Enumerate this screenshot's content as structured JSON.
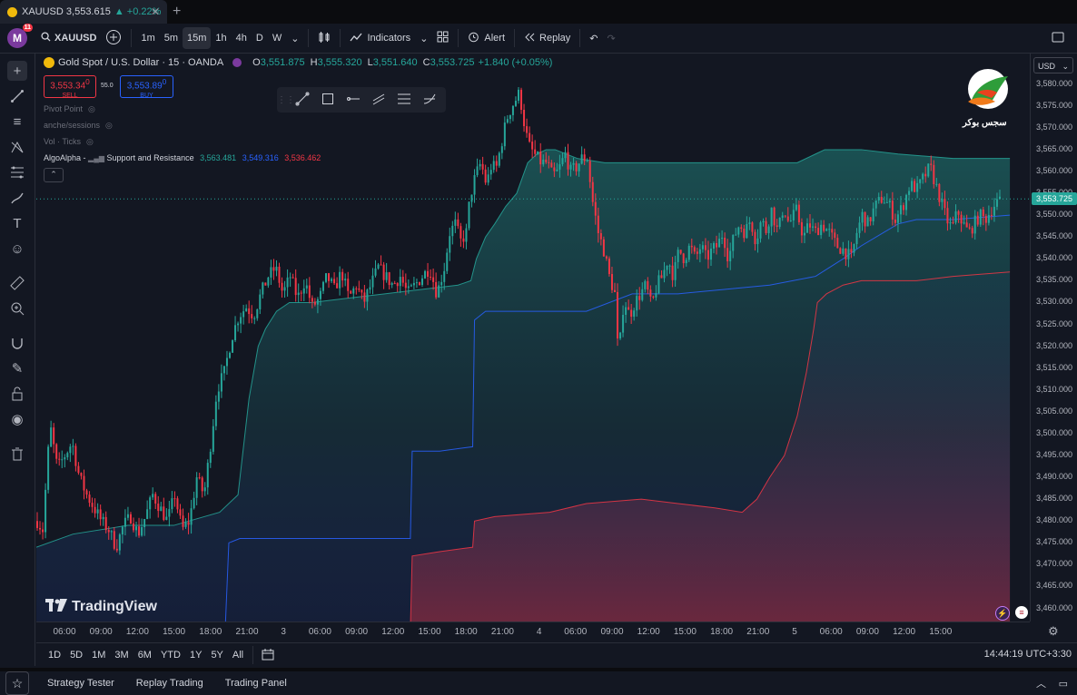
{
  "browser_tab": {
    "symbol": "XAUUSD",
    "price": "3,553.615",
    "change": "▲ +0.22%",
    "close": "✕",
    "new_tab": "+"
  },
  "toolbar": {
    "avatar_letter": "M",
    "avatar_badge": "11",
    "symbol": "XAUUSD",
    "intervals": [
      "1m",
      "5m",
      "15m",
      "1h",
      "4h",
      "D",
      "W"
    ],
    "active_interval": "15m",
    "indicators_label": "Indicators",
    "alert_label": "Alert",
    "replay_label": "Replay"
  },
  "legend": {
    "title": "Gold Spot / U.S. Dollar · 15 · OANDA",
    "o_label": "O",
    "o": "3,551.875",
    "h_label": "H",
    "h": "3,555.320",
    "l_label": "L",
    "l": "3,551.640",
    "c_label": "C",
    "c": "3,553.725",
    "change": "+1.840 (+0.05%)",
    "sell_price": "3,553.34",
    "sell_sup": "0",
    "sell_label": "SELL",
    "spread": "55.0",
    "buy_price": "3,553.89",
    "buy_sup": "0",
    "buy_label": "BUY",
    "indicators": [
      "Pivot Point",
      "anche/sessions",
      "Vol · Ticks"
    ],
    "algo_name": "AlgoAlpha -",
    "algo_title": "Support and Resistance",
    "algo_v1": "3,563.481",
    "algo_v2": "3,549.316",
    "algo_v3": "3,536.462",
    "collapse": "⌃"
  },
  "logo_text": "سجس بوکر",
  "watermark": "TradingView",
  "price_axis": {
    "currency": "USD",
    "labels": [
      "3,580.000",
      "3,575.000",
      "3,570.000",
      "3,565.000",
      "3,560.000",
      "3,555.000",
      "3,550.000",
      "3,545.000",
      "3,540.000",
      "3,535.000",
      "3,530.000",
      "3,525.000",
      "3,520.000",
      "3,515.000",
      "3,510.000",
      "3,505.000",
      "3,500.000",
      "3,495.000",
      "3,490.000",
      "3,485.000",
      "3,480.000",
      "3,475.000",
      "3,470.000",
      "3,465.000",
      "3,460.000"
    ],
    "last_price": "3,553.725"
  },
  "time_axis": {
    "labels": [
      "06:00",
      "09:00",
      "12:00",
      "15:00",
      "18:00",
      "21:00",
      "3",
      "06:00",
      "09:00",
      "12:00",
      "15:00",
      "18:00",
      "21:00",
      "4",
      "06:00",
      "09:00",
      "12:00",
      "15:00",
      "18:00",
      "21:00",
      "5",
      "06:00",
      "09:00",
      "12:00",
      "15:00"
    ]
  },
  "range_bar": {
    "ranges": [
      "1D",
      "5D",
      "1M",
      "3M",
      "6M",
      "YTD",
      "1Y",
      "5Y",
      "All"
    ],
    "clock": "14:44:19 UTC+3:30"
  },
  "bottom_panel": {
    "tabs": [
      "Strategy Tester",
      "Replay Trading",
      "Trading Panel"
    ]
  },
  "colors": {
    "up": "#26a69a",
    "down": "#f23645",
    "support": "#2962ff",
    "bg": "#131722"
  },
  "chart_data": {
    "type": "candlestick",
    "instrument": "XAUUSD",
    "timeframe": "15",
    "ylim": [
      3457,
      3587
    ],
    "last_close": 3553.725,
    "price_path": [
      [
        0,
        3480
      ],
      [
        6,
        3478
      ],
      [
        14,
        3502
      ],
      [
        22,
        3492
      ],
      [
        30,
        3495
      ],
      [
        38,
        3498
      ],
      [
        46,
        3490
      ],
      [
        54,
        3486
      ],
      [
        62,
        3483
      ],
      [
        70,
        3480
      ],
      [
        78,
        3478
      ],
      [
        86,
        3474
      ],
      [
        94,
        3479
      ],
      [
        102,
        3481
      ],
      [
        110,
        3477
      ],
      [
        118,
        3481
      ],
      [
        126,
        3486
      ],
      [
        134,
        3483
      ],
      [
        142,
        3480
      ],
      [
        150,
        3486
      ],
      [
        158,
        3478
      ],
      [
        166,
        3480
      ],
      [
        174,
        3490
      ],
      [
        182,
        3486
      ],
      [
        190,
        3499
      ],
      [
        196,
        3510
      ],
      [
        204,
        3514
      ],
      [
        212,
        3522
      ],
      [
        220,
        3527
      ],
      [
        228,
        3529
      ],
      [
        236,
        3527
      ],
      [
        244,
        3532
      ],
      [
        252,
        3536
      ],
      [
        260,
        3538
      ],
      [
        268,
        3532
      ],
      [
        276,
        3536
      ],
      [
        284,
        3531
      ],
      [
        292,
        3535
      ],
      [
        300,
        3529
      ],
      [
        308,
        3531
      ],
      [
        316,
        3536
      ],
      [
        324,
        3533
      ],
      [
        332,
        3537
      ],
      [
        340,
        3531
      ],
      [
        348,
        3534
      ],
      [
        356,
        3530
      ],
      [
        364,
        3534
      ],
      [
        372,
        3538
      ],
      [
        380,
        3536
      ],
      [
        388,
        3534
      ],
      [
        396,
        3536
      ],
      [
        404,
        3532
      ],
      [
        412,
        3534
      ],
      [
        420,
        3536
      ],
      [
        428,
        3538
      ],
      [
        436,
        3532
      ],
      [
        444,
        3538
      ],
      [
        450,
        3546
      ],
      [
        456,
        3548
      ],
      [
        462,
        3544
      ],
      [
        468,
        3546
      ],
      [
        472,
        3554
      ],
      [
        478,
        3559
      ],
      [
        484,
        3562
      ],
      [
        490,
        3557
      ],
      [
        496,
        3562
      ],
      [
        500,
        3560
      ],
      [
        506,
        3566
      ],
      [
        512,
        3572
      ],
      [
        518,
        3575
      ],
      [
        526,
        3578
      ],
      [
        532,
        3570
      ],
      [
        536,
        3566
      ],
      [
        542,
        3564
      ],
      [
        550,
        3562
      ],
      [
        556,
        3562
      ],
      [
        562,
        3559
      ],
      [
        568,
        3560
      ],
      [
        576,
        3564
      ],
      [
        582,
        3560
      ],
      [
        588,
        3561
      ],
      [
        594,
        3563
      ],
      [
        600,
        3563
      ],
      [
        606,
        3553
      ],
      [
        612,
        3546
      ],
      [
        618,
        3542
      ],
      [
        624,
        3536
      ],
      [
        630,
        3532
      ],
      [
        634,
        3517
      ],
      [
        640,
        3531
      ],
      [
        646,
        3527
      ],
      [
        652,
        3530
      ],
      [
        658,
        3532
      ],
      [
        664,
        3534
      ],
      [
        670,
        3529
      ],
      [
        676,
        3534
      ],
      [
        682,
        3536
      ],
      [
        688,
        3540
      ],
      [
        694,
        3536
      ],
      [
        700,
        3542
      ],
      [
        706,
        3540
      ],
      [
        712,
        3543
      ],
      [
        718,
        3540
      ],
      [
        724,
        3543
      ],
      [
        730,
        3540
      ],
      [
        736,
        3542
      ],
      [
        742,
        3543
      ],
      [
        748,
        3546
      ],
      [
        754,
        3540
      ],
      [
        760,
        3545
      ],
      [
        766,
        3548
      ],
      [
        772,
        3546
      ],
      [
        778,
        3549
      ],
      [
        784,
        3544
      ],
      [
        790,
        3549
      ],
      [
        796,
        3546
      ],
      [
        800,
        3552
      ],
      [
        808,
        3546
      ],
      [
        814,
        3552
      ],
      [
        820,
        3548
      ],
      [
        828,
        3551
      ],
      [
        836,
        3545
      ],
      [
        842,
        3548
      ],
      [
        848,
        3546
      ],
      [
        856,
        3548
      ],
      [
        864,
        3546
      ],
      [
        872,
        3543
      ],
      [
        880,
        3542
      ],
      [
        888,
        3540
      ],
      [
        894,
        3546
      ],
      [
        900,
        3550
      ],
      [
        906,
        3548
      ],
      [
        914,
        3552
      ],
      [
        922,
        3554
      ],
      [
        930,
        3552
      ],
      [
        936,
        3549
      ],
      [
        944,
        3552
      ],
      [
        952,
        3557
      ],
      [
        960,
        3556
      ],
      [
        968,
        3559
      ],
      [
        974,
        3561
      ],
      [
        980,
        3557
      ],
      [
        986,
        3553
      ],
      [
        992,
        3549
      ],
      [
        998,
        3547
      ],
      [
        1004,
        3551
      ],
      [
        1010,
        3548
      ],
      [
        1016,
        3546
      ],
      [
        1022,
        3548
      ],
      [
        1028,
        3550
      ],
      [
        1034,
        3549
      ],
      [
        1040,
        3551
      ],
      [
        1046,
        3553
      ],
      [
        1052,
        3553
      ]
    ],
    "resistance_band": [
      [
        0,
        3474
      ],
      [
        40,
        3477
      ],
      [
        100,
        3479
      ],
      [
        150,
        3479
      ],
      [
        200,
        3482
      ],
      [
        220,
        3486
      ],
      [
        232,
        3508
      ],
      [
        242,
        3520
      ],
      [
        250,
        3524
      ],
      [
        262,
        3528
      ],
      [
        276,
        3530
      ],
      [
        300,
        3530
      ],
      [
        340,
        3531
      ],
      [
        380,
        3532
      ],
      [
        420,
        3533
      ],
      [
        460,
        3534
      ],
      [
        474,
        3535
      ],
      [
        480,
        3540
      ],
      [
        490,
        3545
      ],
      [
        500,
        3548
      ],
      [
        512,
        3552
      ],
      [
        524,
        3555
      ],
      [
        536,
        3562
      ],
      [
        546,
        3564
      ],
      [
        556,
        3565
      ],
      [
        566,
        3565
      ],
      [
        590,
        3563
      ],
      [
        620,
        3562
      ],
      [
        660,
        3562
      ],
      [
        760,
        3562
      ],
      [
        830,
        3562
      ],
      [
        850,
        3564
      ],
      [
        860,
        3565
      ],
      [
        900,
        3565
      ],
      [
        940,
        3564
      ],
      [
        1000,
        3563
      ],
      [
        1062,
        3563
      ]
    ],
    "support_line": [
      [
        0,
        3455
      ],
      [
        206,
        3455
      ],
      [
        210,
        3475
      ],
      [
        222,
        3476
      ],
      [
        270,
        3476
      ],
      [
        408,
        3476
      ],
      [
        410,
        3496
      ],
      [
        440,
        3496
      ],
      [
        476,
        3497
      ],
      [
        478,
        3526
      ],
      [
        490,
        3528
      ],
      [
        600,
        3528
      ],
      [
        650,
        3532
      ],
      [
        700,
        3532
      ],
      [
        800,
        3534
      ],
      [
        850,
        3536
      ],
      [
        880,
        3540
      ],
      [
        900,
        3543
      ],
      [
        940,
        3548
      ],
      [
        960,
        3549
      ],
      [
        1000,
        3549
      ],
      [
        1062,
        3550
      ]
    ],
    "lower_band": [
      [
        408,
        3455
      ],
      [
        410,
        3472
      ],
      [
        440,
        3473
      ],
      [
        476,
        3474
      ],
      [
        478,
        3480
      ],
      [
        500,
        3481
      ],
      [
        560,
        3482
      ],
      [
        600,
        3484
      ],
      [
        660,
        3485
      ],
      [
        700,
        3484
      ],
      [
        740,
        3483
      ],
      [
        770,
        3482
      ],
      [
        786,
        3485
      ],
      [
        800,
        3490
      ],
      [
        816,
        3495
      ],
      [
        830,
        3504
      ],
      [
        840,
        3514
      ],
      [
        848,
        3524
      ],
      [
        852,
        3530
      ],
      [
        862,
        3532
      ],
      [
        880,
        3534
      ],
      [
        900,
        3535
      ],
      [
        960,
        3535
      ],
      [
        1000,
        3536
      ],
      [
        1062,
        3537
      ]
    ]
  }
}
